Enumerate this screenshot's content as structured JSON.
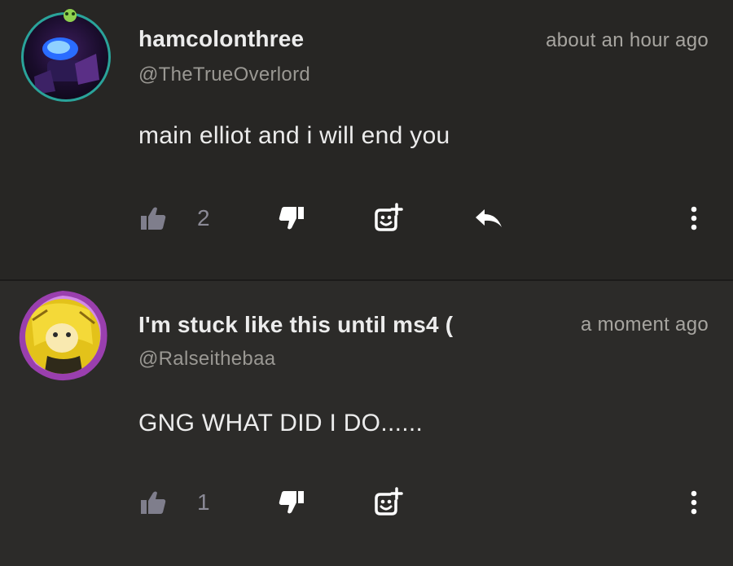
{
  "comments": [
    {
      "username": "hamcolonthree",
      "handle": "@TheTrueOverlord",
      "timestamp": "about an hour ago",
      "body": "main elliot and i will end you",
      "like_count": "2",
      "has_reply": true
    },
    {
      "username": "I'm stuck like this until ms4 (",
      "handle": "@Ralseithebaa",
      "timestamp": "a moment ago",
      "body": "GNG WHAT DID I DO......",
      "like_count": "1",
      "has_reply": false
    }
  ],
  "colors": {
    "background": "#272624",
    "background_alt": "#2c2b29",
    "text_primary": "#ececec",
    "text_secondary": "#9a9893",
    "like_icon": "#7f7e8c",
    "icon_white": "#ffffff"
  },
  "icons": {
    "like": "thumbs-up-icon",
    "dislike": "thumbs-down-icon",
    "react": "add-reaction-icon",
    "reply": "reply-arrow-icon",
    "more": "more-vertical-icon"
  }
}
